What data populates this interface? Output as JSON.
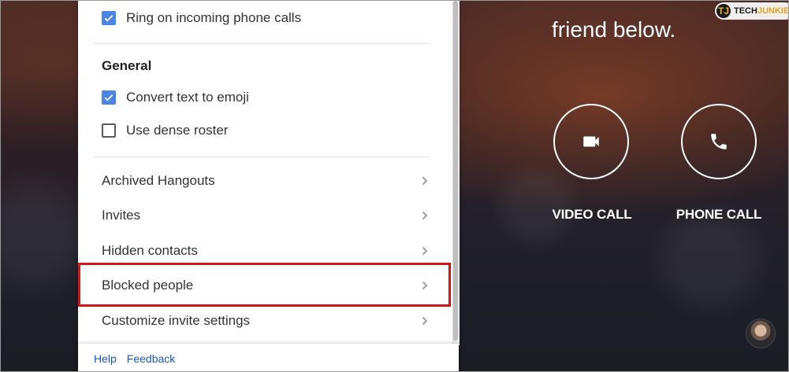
{
  "settings_panel": {
    "ring_calls": {
      "label": "Ring on incoming phone calls",
      "checked": true
    },
    "general_title": "General",
    "convert_emoji": {
      "label": "Convert text to emoji",
      "checked": true
    },
    "dense_roster": {
      "label": "Use dense roster",
      "checked": false
    },
    "nav_items": [
      {
        "label": "Archived Hangouts"
      },
      {
        "label": "Invites"
      },
      {
        "label": "Hidden contacts"
      },
      {
        "label": "Blocked people",
        "highlighted": true
      },
      {
        "label": "Customize invite settings"
      }
    ],
    "footer": {
      "help": "Help",
      "feedback": "Feedback"
    }
  },
  "main": {
    "headline": "friend below.",
    "video_call_label": "VIDEO CALL",
    "phone_call_label": "PHONE CALL"
  },
  "watermark": {
    "brand": "TECHJUNKIE",
    "mark": "TJ"
  },
  "colors": {
    "checkbox_checked": "#4a86e8",
    "highlight_border": "#d01818",
    "link": "#1a56b8"
  },
  "icons": [
    "check-icon",
    "chevron-right-icon",
    "videocam-icon",
    "phone-icon"
  ]
}
